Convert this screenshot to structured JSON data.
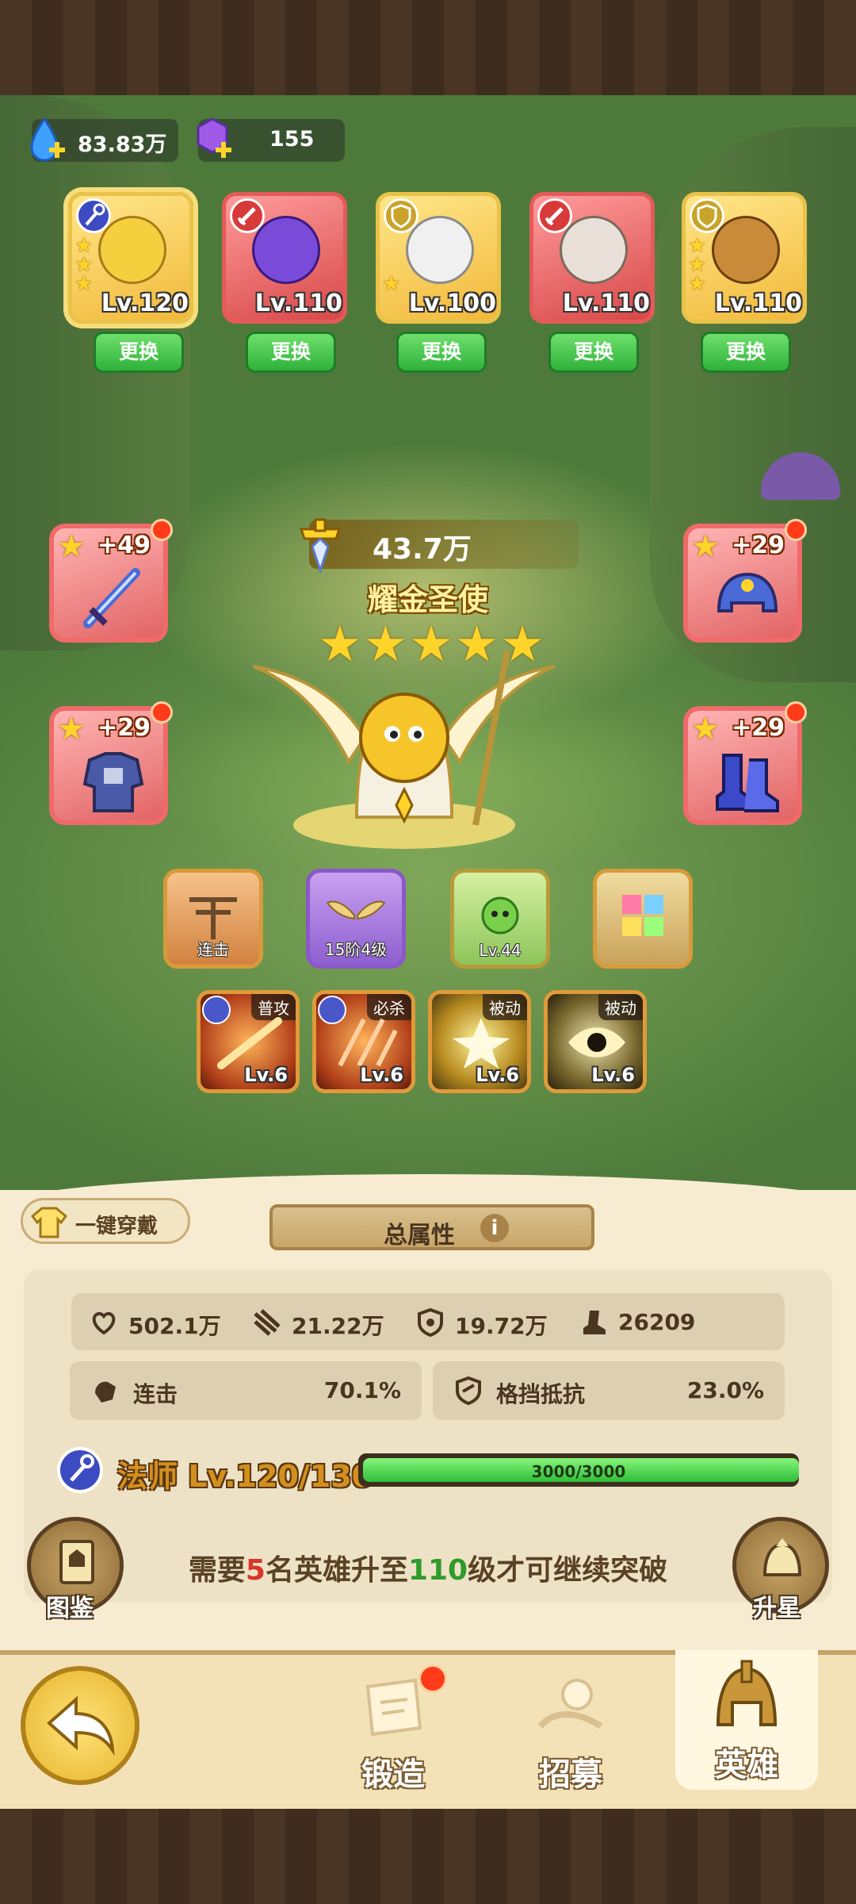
{
  "currency": {
    "water": "83.83万",
    "gems": "155"
  },
  "heroes": [
    {
      "level": "Lv.120",
      "role": "mage",
      "stars": 3,
      "selected": true,
      "swap_label": "更换"
    },
    {
      "level": "Lv.110",
      "role": "warrior",
      "stars": 0,
      "selected": false,
      "swap_label": "更换"
    },
    {
      "level": "Lv.100",
      "role": "tank",
      "stars": 1,
      "selected": false,
      "swap_label": "更换"
    },
    {
      "level": "Lv.110",
      "role": "warrior",
      "stars": 0,
      "selected": false,
      "swap_label": "更换"
    },
    {
      "level": "Lv.110",
      "role": "tank",
      "stars": 3,
      "selected": false,
      "swap_label": "更换"
    }
  ],
  "equipment": {
    "weapon": "+49",
    "helmet": "+29",
    "armor": "+29",
    "boots": "+29"
  },
  "hero": {
    "power": "43.7万",
    "name": "耀金圣使",
    "stars": "★★★★★"
  },
  "functions": {
    "combo_label": "连击",
    "wings_label": "15阶4级",
    "pet_label": "Lv.44"
  },
  "skills": [
    {
      "tag": "普攻",
      "level": "Lv.6"
    },
    {
      "tag": "必杀",
      "level": "Lv.6"
    },
    {
      "tag": "被动",
      "level": "Lv.6"
    },
    {
      "tag": "被动",
      "level": "Lv.6"
    }
  ],
  "panel": {
    "wear_all": "一键穿戴",
    "attr_title": "总属性",
    "info_icon": "i",
    "hp": "502.1万",
    "attack": "21.22万",
    "defense": "19.72万",
    "speed": "26209",
    "combo_label": "连击",
    "combo_value": "70.1%",
    "block_label": "格挡抵抗",
    "block_value": "23.0%",
    "class_text": "法师 Lv.120/130",
    "exp_text": "3000/3000",
    "exp_fraction": 1.0,
    "break_pre": "需要",
    "break_num": "5",
    "break_mid": "名英雄升至",
    "break_lv": "110",
    "break_post": "级才可继续突破",
    "codex_label": "图鉴",
    "star_up_label": "升星"
  },
  "nav": {
    "forge": "锻造",
    "recruit": "招募",
    "hero": "英雄"
  },
  "colors": {
    "accent_gold": "#e9c24a",
    "accent_red": "#e45a5a",
    "exp_green": "#2fbd3b"
  }
}
